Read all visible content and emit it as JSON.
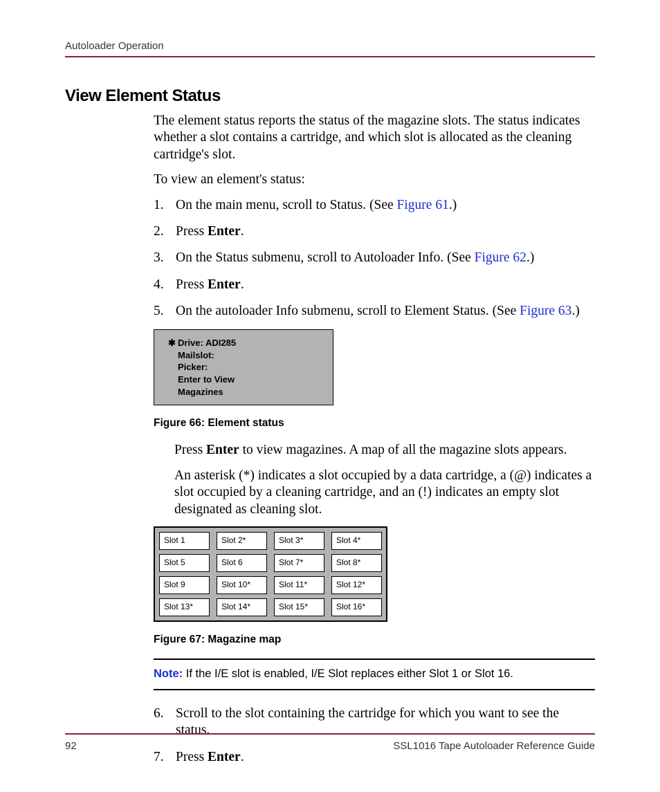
{
  "header": {
    "running": "Autoloader Operation"
  },
  "h2": "View Element Status",
  "intro": "The element status reports the status of the magazine slots. The status indicates whether a slot contains a cartridge, and which slot is allocated as the cleaning cartridge's slot.",
  "lead": "To view an element's status:",
  "steps1": {
    "s1a": "On the main menu, scroll to Status. (See ",
    "s1link": "Figure 61",
    "s1b": ".)",
    "s2a": "Press ",
    "s2b": "Enter",
    "s2c": ".",
    "s3a": "On the Status submenu, scroll to Autoloader Info. (See ",
    "s3link": "Figure 62",
    "s3b": ".)",
    "s4a": "Press ",
    "s4b": "Enter",
    "s4c": ".",
    "s5a": "On the autoloader Info submenu, scroll to Element Status. (See ",
    "s5link": "Figure 63",
    "s5b": ".)"
  },
  "lcd": {
    "star": "✱",
    "l1": "Drive: ADI285",
    "l2": "Mailslot:",
    "l3": "Picker:",
    "l4": "Enter to View",
    "l5": "Magazines"
  },
  "fig66": "Figure 66:  Element status",
  "after": {
    "p1a": "Press ",
    "p1b": "Enter",
    "p1c": " to view magazines. A map of all the magazine slots appears.",
    "p2": "An asterisk (*) indicates a slot occupied by a data cartridge, a (@) indicates a slot occupied by a cleaning cartridge, and an (!) indicates an empty slot designated as cleaning slot."
  },
  "map": {
    "cells": [
      "Slot 1",
      "Slot 2*",
      "Slot 3*",
      "Slot 4*",
      "Slot 5",
      "Slot 6",
      "Slot 7*",
      "Slot 8*",
      "Slot 9",
      "Slot 10*",
      "Slot 11*",
      "Slot 12*",
      "Slot 13*",
      "Slot 14*",
      "Slot 15*",
      "Slot 16*"
    ]
  },
  "fig67": "Figure 67:  Magazine map",
  "note": {
    "label": "Note:",
    "text": "  If the I/E slot is enabled, I/E Slot replaces either Slot 1 or Slot 16."
  },
  "steps2": {
    "s6": "Scroll to the slot containing the cartridge for which you want to see the status.",
    "s7a": "Press ",
    "s7b": "Enter",
    "s7c": "."
  },
  "footer": {
    "page": "92",
    "title": "SSL1016 Tape Autoloader Reference Guide"
  }
}
